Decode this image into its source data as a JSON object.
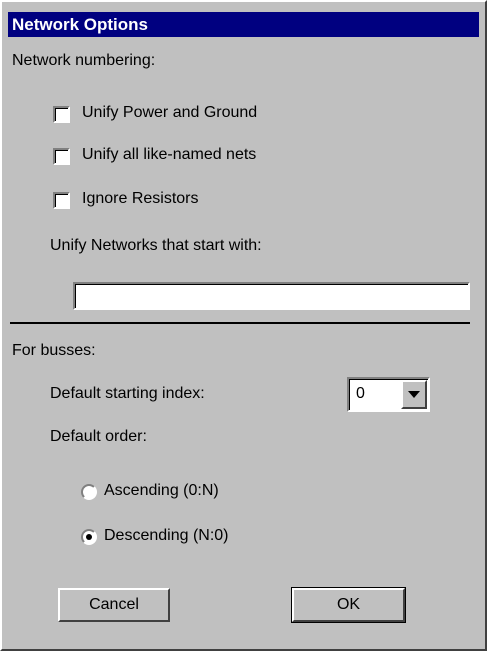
{
  "dialog": {
    "title": "Network Options",
    "network_numbering_label": "Network numbering:",
    "checkboxes": [
      {
        "label": "Unify Power and Ground",
        "checked": false
      },
      {
        "label": "Unify all like-named nets",
        "checked": false
      },
      {
        "label": "Ignore Resistors",
        "checked": false
      }
    ],
    "unify_prefix_label": "Unify Networks that start with:",
    "unify_prefix_value": "",
    "busses_label": "For busses:",
    "starting_index_label": "Default starting index:",
    "starting_index_value": "0",
    "default_order_label": "Default order:",
    "order_options": [
      {
        "label": "Ascending (0:N)",
        "selected": false
      },
      {
        "label": "Descending (N:0)",
        "selected": true
      }
    ],
    "cancel_label": "Cancel",
    "ok_label": "OK"
  }
}
